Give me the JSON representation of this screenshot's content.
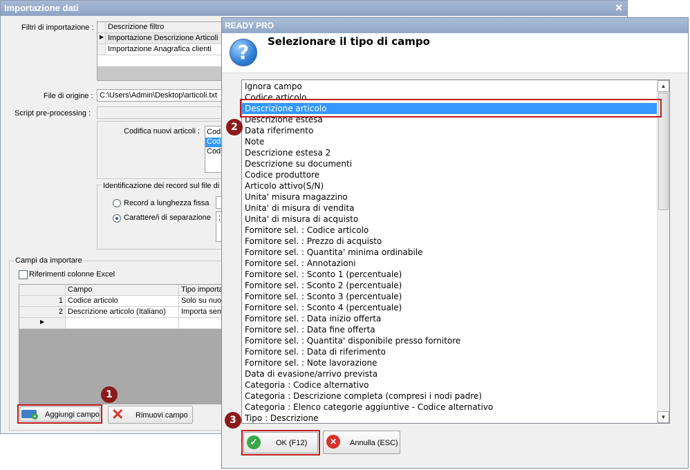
{
  "background_window": {
    "title": "Importazione dati",
    "filters_label": "Filtri di importazione :",
    "filters_header": "Descrizione filtro",
    "filters": [
      "Importazione Descrizione Articoli",
      "Importazione Anagrafica clienti"
    ],
    "source_file_label": "File di origine :",
    "source_file_value": "C:\\Users\\Admin\\Desktop\\articoli.txt",
    "script_label": "Script pre-processing :",
    "encoding_label": "Codifica nuovi articoli :",
    "encoding_items": [
      "Codi",
      "Codi",
      "Codi"
    ],
    "record_id_label": "Identificazione dei record sul file di c",
    "radio_fixed": "Record a lunghezza fissa",
    "radio_separator": "Carattere/i di separazione",
    "separator_chars": ";",
    "fields_group": "Campi da importare",
    "excel_checkbox": "Riferimenti colonne Excel",
    "fields_table": {
      "headers": [
        "Campo",
        "Tipo importaz"
      ],
      "rows": [
        {
          "num": "1",
          "field": "Codice articolo",
          "type": "Solo su nuovi"
        },
        {
          "num": "2",
          "field": "Descrizione articolo (Italiano)",
          "type": "Importa semp"
        }
      ]
    },
    "add_button": "Aggiungi campo",
    "remove_button": "Rimuovi campo"
  },
  "dialog": {
    "title": "READY PRO",
    "heading": "Selezionare il tipo di campo",
    "icon": "question-icon",
    "selected_index": 2,
    "options": [
      "Ignora campo",
      "Codice articolo",
      "Descrizione articolo",
      "Descrizione estesa",
      "Data riferimento",
      "Note",
      "Descrizione estesa 2",
      "Descrizione su documenti",
      "Codice produttore",
      "Articolo attivo(S/N)",
      "Unita' misura magazzino",
      "Unita' di misura di vendita",
      "Unita' di misura di acquisto",
      "Fornitore sel. : Codice articolo",
      "Fornitore sel. : Prezzo di acquisto",
      "Fornitore sel. : Quantita' minima ordinabile",
      "Fornitore sel. : Annotazioni",
      "Fornitore sel. : Sconto 1 (percentuale)",
      "Fornitore sel. : Sconto 2 (percentuale)",
      "Fornitore sel. : Sconto 3 (percentuale)",
      "Fornitore sel. : Sconto 4 (percentuale)",
      "Fornitore sel. : Data inizio offerta",
      "Fornitore sel. : Data fine offerta",
      "Fornitore sel. : Quantita' disponibile presso fornitore",
      "Fornitore sel. : Data di riferimento",
      "Fornitore sel. : Note lavorazione",
      "Data di evasione/arrivo prevista",
      "Categoria : Codice alternativo",
      "Categoria : Descrizione completa (compresi i nodi padre)",
      "Categoria : Elenco categorie aggiuntive - Codice alternativo",
      "Tipo : Descrizione"
    ],
    "ok_button": "OK (F12)",
    "cancel_button": "Annulla (ESC)"
  },
  "annotations": {
    "badge_1": "1",
    "badge_2": "2",
    "badge_3": "3",
    "highlight_color": "#c11c1c"
  }
}
